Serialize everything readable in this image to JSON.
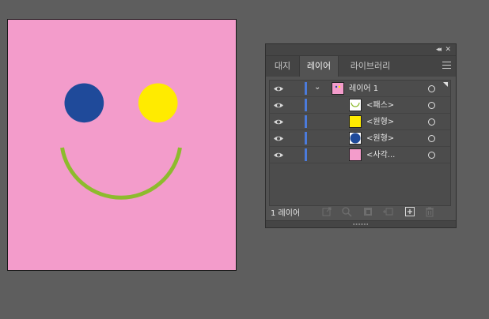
{
  "artboard": {
    "background": "#f39ccb",
    "left_eye_color": "#1f4a9a",
    "right_eye_color": "#ffeb00",
    "smile_color": "#8dbb2d"
  },
  "panel": {
    "header_buttons": [
      "collapse-icon",
      "close-icon"
    ],
    "tabs": [
      {
        "label": "대지",
        "active": false
      },
      {
        "label": "레이어",
        "active": true
      },
      {
        "label": "라이브러리",
        "active": false
      }
    ],
    "layer_bar_color": "#4b7bdb",
    "layers": [
      {
        "label": "레이어 1",
        "type": "layer",
        "thumb": "pink"
      },
      {
        "label": "<패스>",
        "type": "path",
        "thumb": "smile"
      },
      {
        "label": "<원형>",
        "type": "ellipse",
        "thumb": "yellow"
      },
      {
        "label": "<원형>",
        "type": "ellipse",
        "thumb": "blue-circle"
      },
      {
        "label": "<사각...",
        "type": "rect",
        "thumb": "pink"
      }
    ],
    "footer": {
      "layer_count": "1 레이어",
      "icons": [
        "export-icon",
        "search-icon",
        "clip-mask-icon",
        "sublayer-icon",
        "new-layer-icon",
        "trash-icon"
      ]
    }
  }
}
